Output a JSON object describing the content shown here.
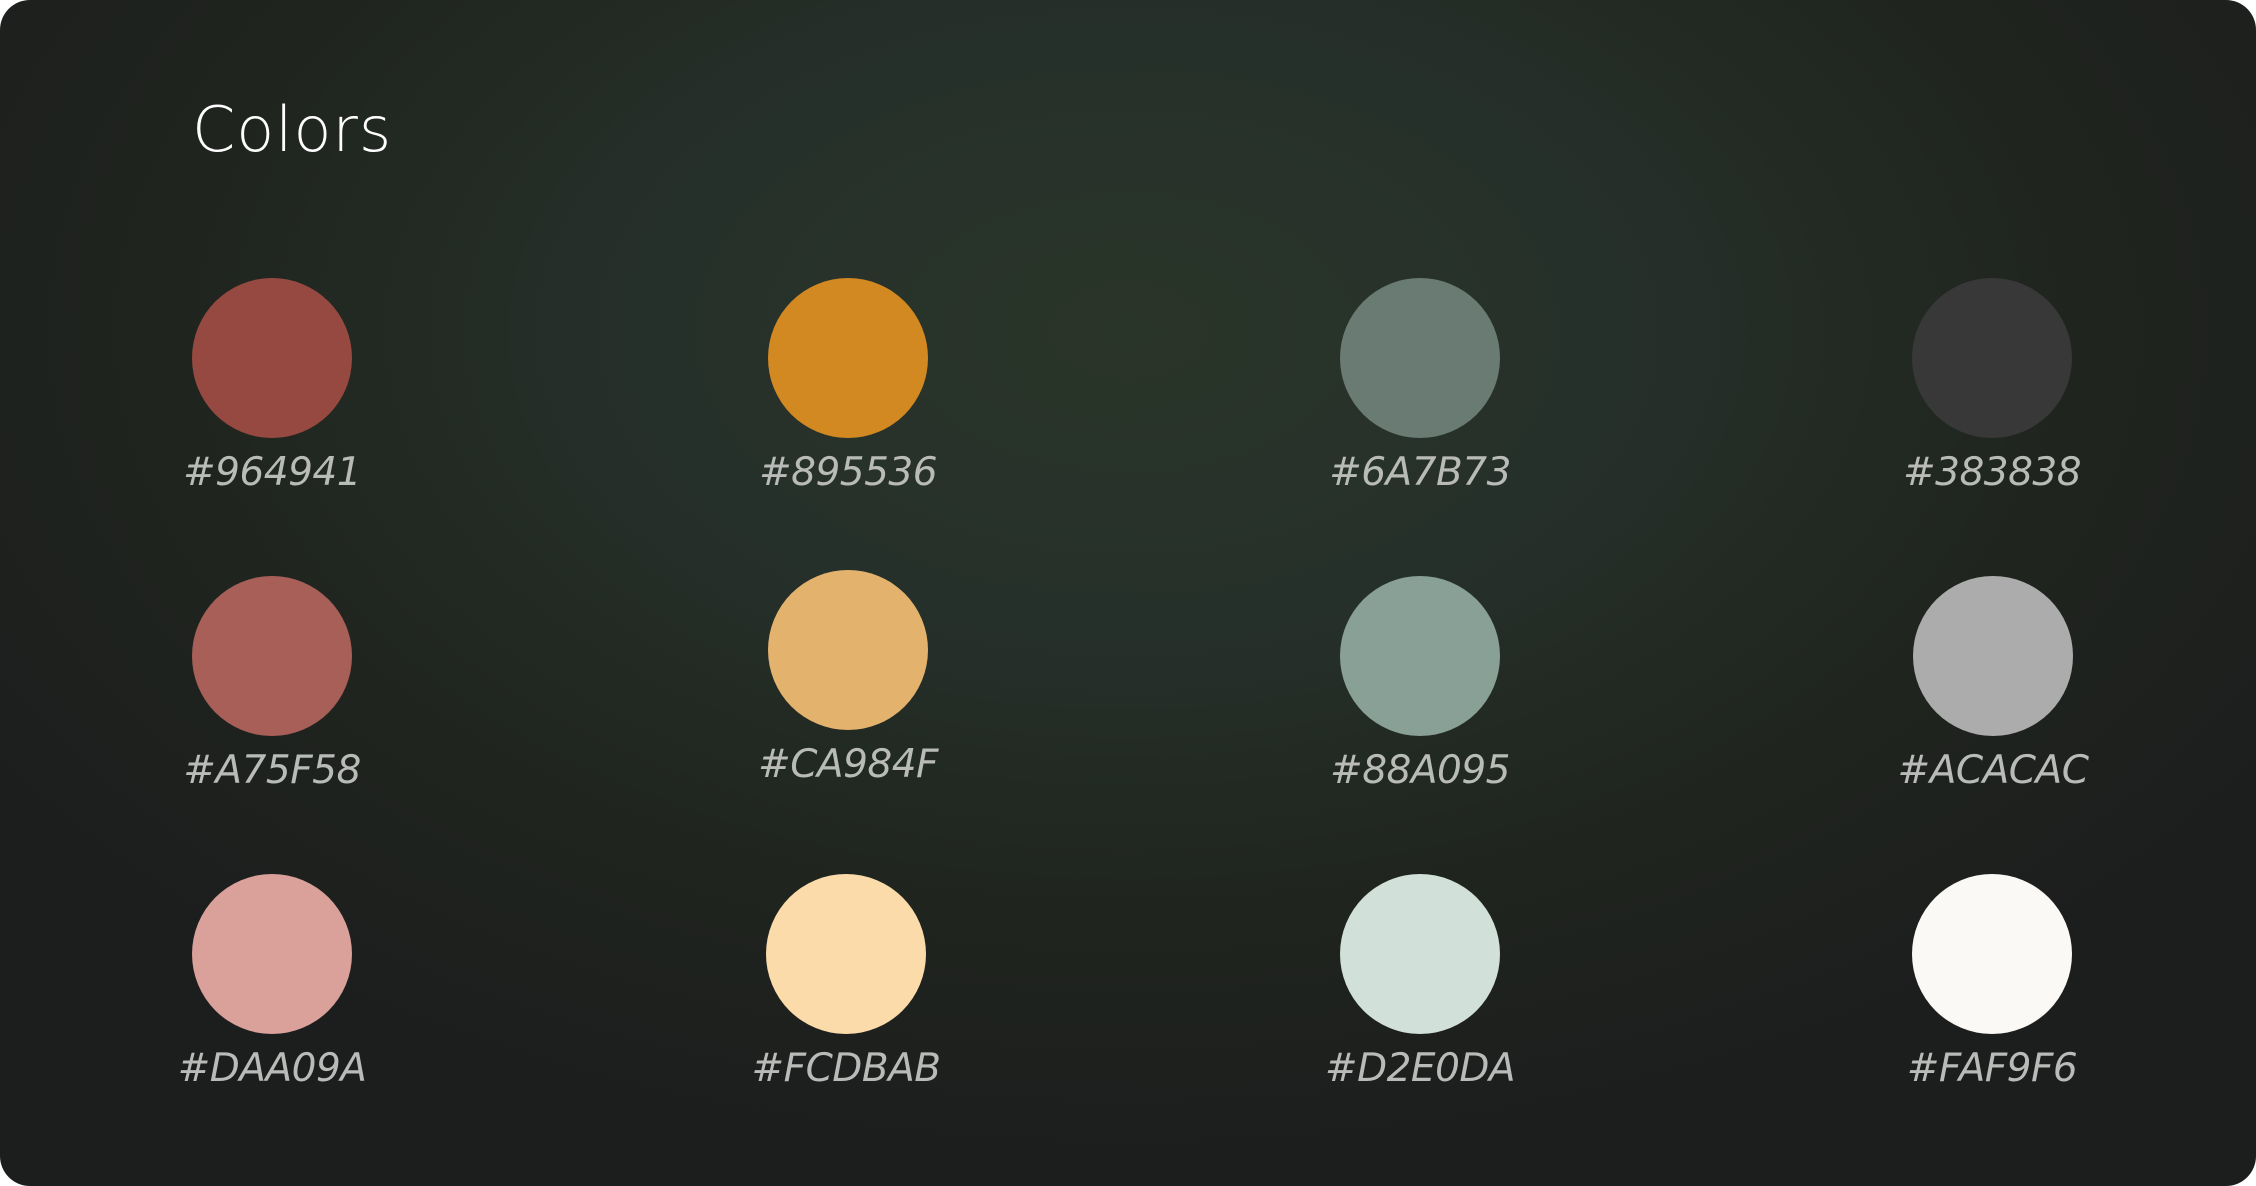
{
  "page": {
    "title": "Colors"
  },
  "swatches": [
    {
      "label": "#964941",
      "fill": "#964941"
    },
    {
      "label": "#895536",
      "fill": "#D38922"
    },
    {
      "label": "#6A7B73",
      "fill": "#6A7B73"
    },
    {
      "label": "#383838",
      "fill": "#383838"
    },
    {
      "label": "#A75F58",
      "fill": "#A75F58"
    },
    {
      "label": "#CA984F",
      "fill": "#E3B36D"
    },
    {
      "label": "#88A095",
      "fill": "#88A095"
    },
    {
      "label": "#ACACAC",
      "fill": "#ACACAC"
    },
    {
      "label": "#DAA09A",
      "fill": "#DAA09A"
    },
    {
      "label": "#FCDBAB",
      "fill": "#FCDBAB"
    },
    {
      "label": "#D2E0DA",
      "fill": "#D2E0DA"
    },
    {
      "label": "#FAF9F6",
      "fill": "#FAF9F6"
    }
  ]
}
